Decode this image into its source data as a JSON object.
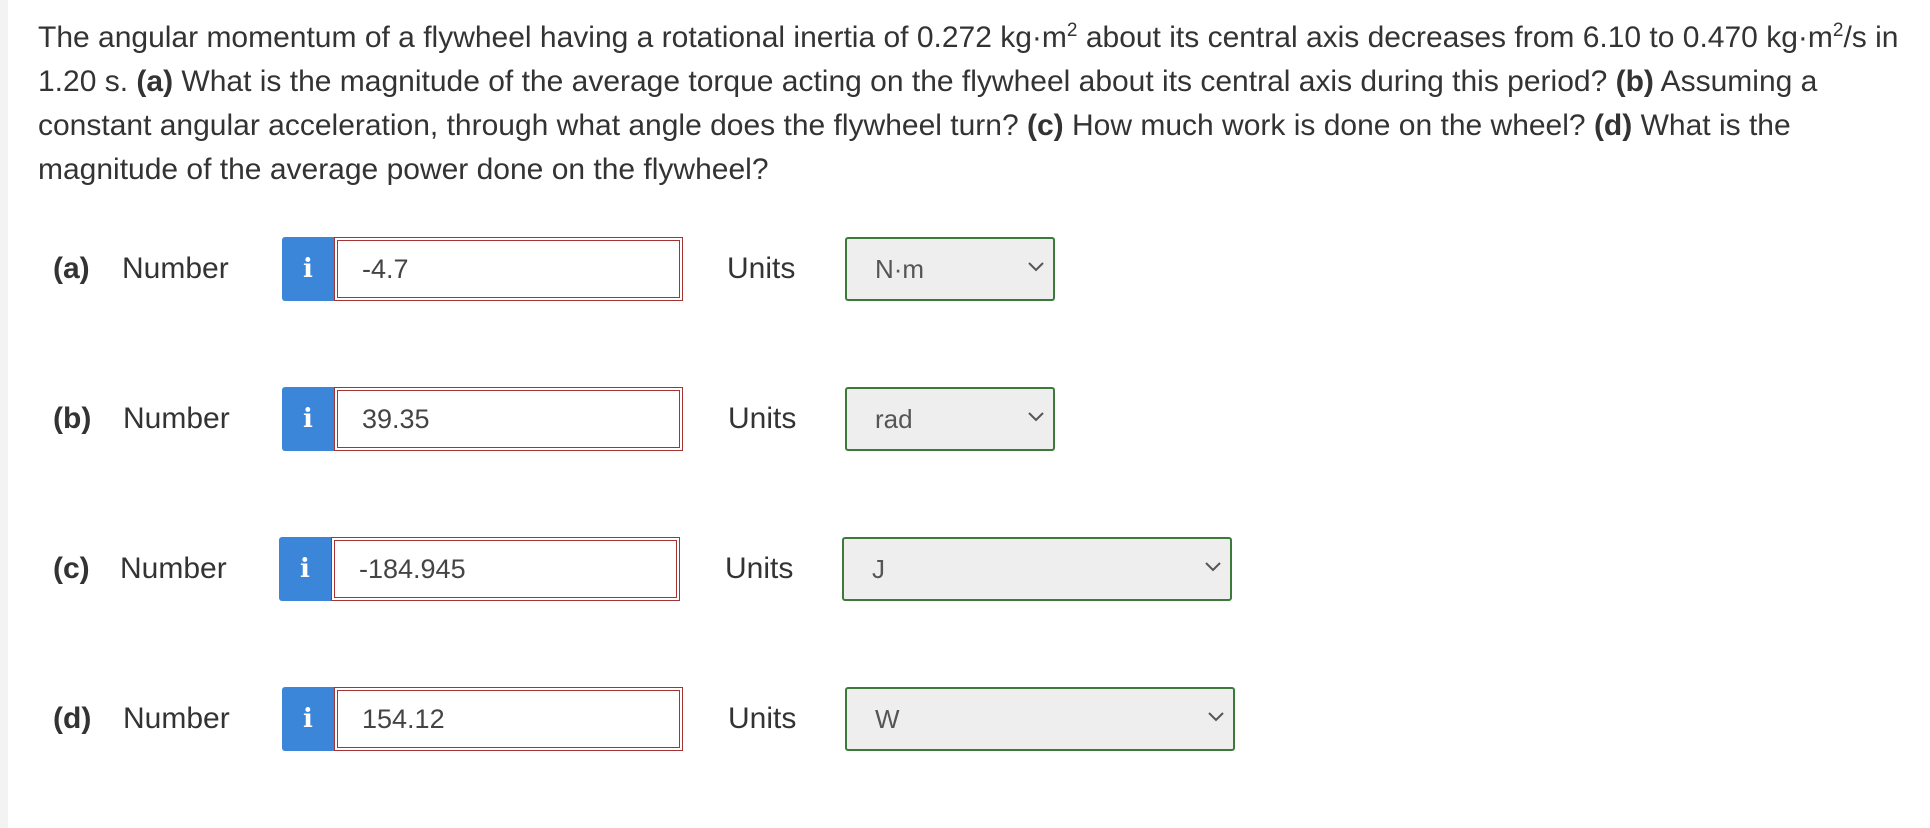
{
  "question": {
    "intro": "The angular momentum of a flywheel having a rotational inertia of 0.272 kg·m",
    "sup1": "2",
    "mid1": " about its central axis decreases from 6.10 to 0.470 kg·m",
    "sup2": "2",
    "mid2": "/s in 1.20 s. ",
    "a_label": "(a)",
    "a_text": " What is the magnitude of the average torque acting on the flywheel about its central axis during this period? ",
    "b_label": "(b)",
    "b_text": " Assuming a constant angular acceleration, through what angle does the flywheel turn? ",
    "c_label": "(c)",
    "c_text": " How much work is done on the wheel? ",
    "d_label": "(d)",
    "d_text": " What is the magnitude of the average power done on the flywheel?"
  },
  "parts": [
    {
      "label": "(a)",
      "number_label": "Number",
      "info_icon": "i",
      "value": "-4.7",
      "units_label": "Units",
      "unit": "N·m"
    },
    {
      "label": "(b)",
      "number_label": "Number",
      "info_icon": "i",
      "value": "39.35",
      "units_label": "Units",
      "unit": "rad"
    },
    {
      "label": "(c)",
      "number_label": "Number",
      "info_icon": "i",
      "value": "-184.945",
      "units_label": "Units",
      "unit": "J"
    },
    {
      "label": "(d)",
      "number_label": "Number",
      "info_icon": "i",
      "value": "154.12",
      "units_label": "Units",
      "unit": "W"
    }
  ],
  "colors": {
    "info_button": "#3b86d9",
    "incorrect_border": "#a43434",
    "correct_border": "#3c7a3c"
  },
  "icons": {
    "info": "info-icon",
    "dropdown": "chevron-down-icon"
  }
}
